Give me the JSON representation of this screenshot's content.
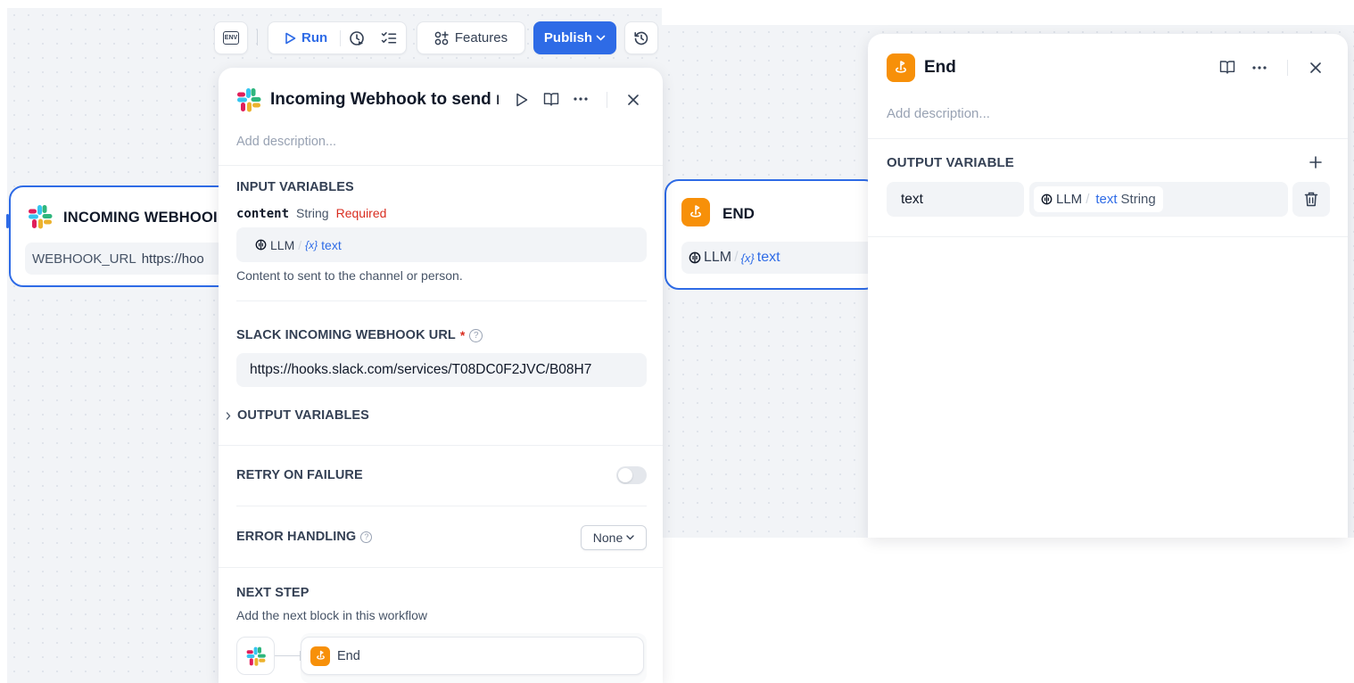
{
  "toolbar": {
    "env_label": "ENV",
    "run_label": "Run",
    "features_label": "Features",
    "publish_label": "Publish"
  },
  "canvas": {
    "webhook_node": {
      "title": "INCOMING WEBHOOI",
      "field_key": "WEBHOOK_URL",
      "field_value": "https://hoo"
    },
    "end_node": {
      "title": "END",
      "var_source": "LLM",
      "var_sep": "/",
      "var_name": "text"
    }
  },
  "webhook_panel": {
    "title": "Incoming Webhook to send r",
    "description_placeholder": "Add description...",
    "input_variables": {
      "heading": "INPUT VARIABLES",
      "var_name": "content",
      "var_type": "String",
      "var_required": "Required",
      "ref_source": "LLM",
      "ref_sep": "/",
      "ref_name": "text",
      "help": "Content to sent to the channel or person."
    },
    "slack_url": {
      "heading": "SLACK INCOMING WEBHOOK URL",
      "required_mark": "*",
      "value": "https://hooks.slack.com/services/T08DC0F2JVC/B08H7"
    },
    "output_variables": {
      "heading": "OUTPUT VARIABLES"
    },
    "retry": {
      "heading": "RETRY ON FAILURE",
      "enabled": false
    },
    "error_handling": {
      "heading": "ERROR HANDLING",
      "selected": "None"
    },
    "next_step": {
      "heading": "NEXT STEP",
      "subtitle": "Add the next block in this workflow",
      "target_label": "End"
    }
  },
  "end_panel": {
    "title": "End",
    "description_placeholder": "Add description...",
    "output_variable": {
      "heading": "OUTPUT VARIABLE",
      "name": "text",
      "ref_source": "LLM",
      "ref_sep": "/",
      "ref_name": "text",
      "ref_type": "String"
    }
  },
  "colors": {
    "accent": "#2e6be6",
    "end_orange": "#f79009",
    "required_red": "#d92d20",
    "canvas_bg": "#f2f4f7"
  }
}
